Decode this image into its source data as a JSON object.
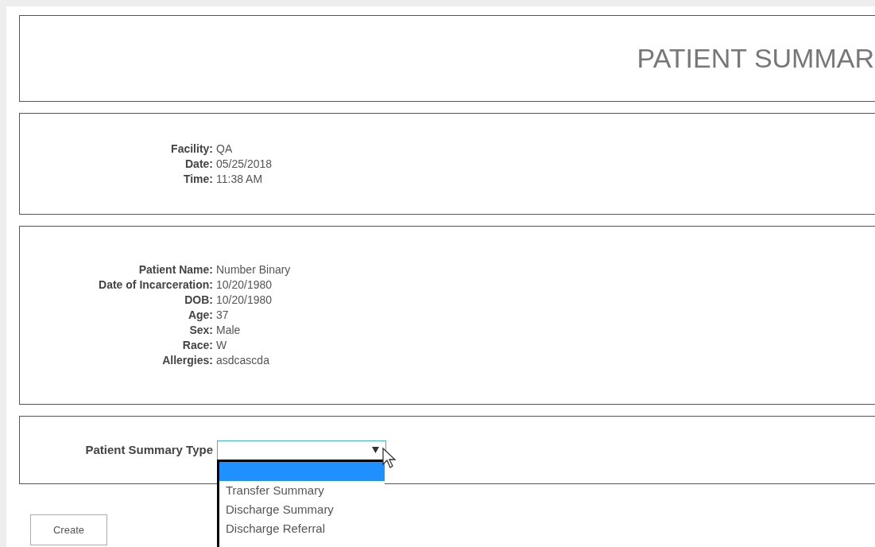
{
  "title": "PATIENT SUMMAR",
  "facility_info": [
    {
      "label": "Facility:",
      "value": "QA"
    },
    {
      "label": "Date:",
      "value": "05/25/2018"
    },
    {
      "label": "Time:",
      "value": "11:38 AM"
    }
  ],
  "patient_info": [
    {
      "label": "Patient Name:",
      "value": "Number Binary"
    },
    {
      "label": "Date of Incarceration:",
      "value": "10/20/1980"
    },
    {
      "label": "DOB:",
      "value": "10/20/1980"
    },
    {
      "label": "Age:",
      "value": "37"
    },
    {
      "label": "Sex:",
      "value": "Male"
    },
    {
      "label": "Race:",
      "value": "W"
    },
    {
      "label": "Allergies:",
      "value": "asdcascda"
    }
  ],
  "summary_type": {
    "label": "Patient Summary Type",
    "expanded": true,
    "options": [
      {
        "selected": true
      },
      {
        "label": "Transfer Summary",
        "selected": false
      },
      {
        "label": "Discharge Summary",
        "selected": false
      },
      {
        "label": "Discharge Referral",
        "selected": false
      }
    ]
  },
  "create_button": "Create"
}
